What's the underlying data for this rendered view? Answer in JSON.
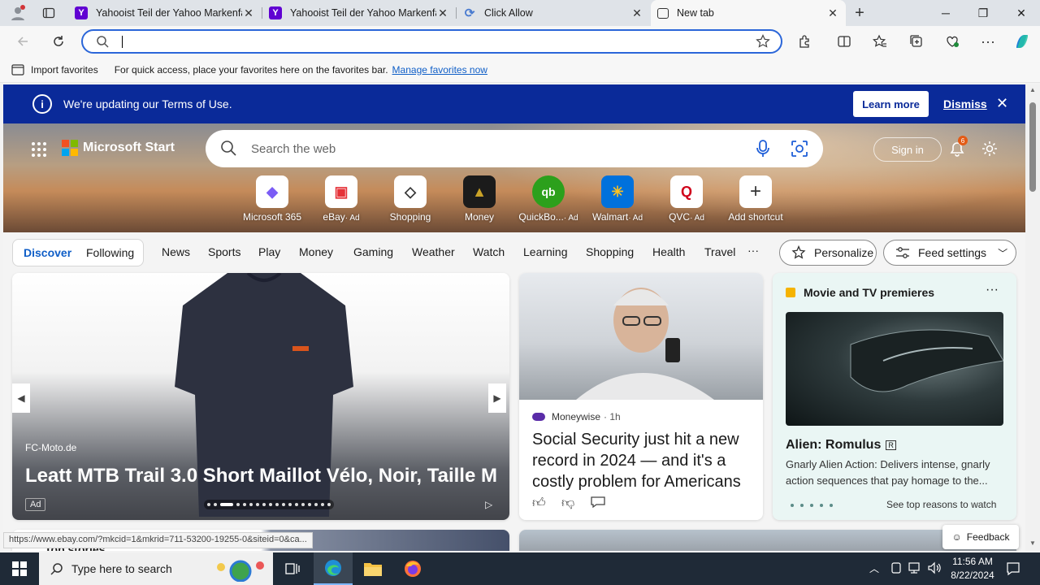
{
  "tabs": [
    {
      "title": "Yahooist Teil der Yahoo Markenfamilie",
      "favicon": "yahoo-icon",
      "color": "#6001d2"
    },
    {
      "title": "Yahooist Teil der Yahoo Markenfamilie",
      "favicon": "yahoo-icon",
      "color": "#6001d2"
    },
    {
      "title": "Click Allow",
      "favicon": "refresh-icon",
      "color": "#4a7bd0"
    },
    {
      "title": "New tab",
      "favicon": "newtab-icon",
      "color": "#333333"
    }
  ],
  "window_controls": {
    "minimize": "─",
    "restore": "❐",
    "close": "✕"
  },
  "address_bar": {
    "value": "",
    "placeholder": ""
  },
  "favorites_bar": {
    "import_label": "Import favorites",
    "message": "For quick access, place your favorites here on the favorites bar.",
    "manage_link": "Manage favorites now"
  },
  "notice": {
    "text": "We're updating our Terms of Use.",
    "learn_more": "Learn more",
    "dismiss": "Dismiss"
  },
  "header": {
    "brand": "Microsoft Start",
    "search_placeholder": "Search the web",
    "sign_in": "Sign in",
    "notification_count": "6"
  },
  "shortcuts": [
    {
      "label": "Microsoft 365",
      "ad": "",
      "icon": "m365-icon",
      "glyph": "◆",
      "color": "#7b5cf5"
    },
    {
      "label": "eBay",
      "ad": "· Ad",
      "icon": "ebay-icon",
      "glyph": "▣",
      "color": "#e53238"
    },
    {
      "label": "Shopping",
      "ad": "",
      "icon": "tag-icon",
      "glyph": "◇",
      "color": "#333333"
    },
    {
      "label": "Money",
      "ad": "",
      "icon": "money-icon",
      "glyph": "▲",
      "color": "#c9a227"
    },
    {
      "label": "QuickBo...",
      "ad": "· Ad",
      "icon": "quickbooks-icon",
      "glyph": "qb",
      "color": "#2ca01c"
    },
    {
      "label": "Walmart",
      "ad": "· Ad",
      "icon": "walmart-icon",
      "glyph": "✳",
      "color": "#0071dc"
    },
    {
      "label": "QVC",
      "ad": "· Ad",
      "icon": "qvc-icon",
      "glyph": "Q",
      "color": "#d0021b"
    },
    {
      "label": "Add shortcut",
      "ad": "",
      "icon": "plus-icon",
      "glyph": "+",
      "color": "#333333"
    }
  ],
  "feed_nav": {
    "discover": "Discover",
    "following": "Following",
    "items": [
      "News",
      "Sports",
      "Play",
      "Money",
      "Gaming",
      "Weather",
      "Watch",
      "Learning",
      "Shopping",
      "Health",
      "Travel"
    ],
    "more": "···",
    "personalize": "Personalize",
    "feed_settings": "Feed settings"
  },
  "ad_card": {
    "source": "FC-Moto.de",
    "headline": "Leatt MTB Trail 3.0 Short Maillot Vélo, Noir, Taille M",
    "ad_label": "Ad"
  },
  "news_card": {
    "publisher": "Moneywise",
    "age": "· 1h",
    "headline": "Social Security just hit a new record in 2024 — and it's a costly problem for Americans"
  },
  "movie_card": {
    "header": "Movie and TV premieres",
    "title": "Alien: Romulus",
    "rating": "R",
    "description": "Gnarly Alien Action: Delivers intense, gnarly action sequences that pay homage to the...",
    "see_top": "See top reasons to watch"
  },
  "lower": {
    "top_stories": "Top stories"
  },
  "feedback": "Feedback",
  "status_url": "https://www.ebay.com/?mkcid=1&mkrid=711-53200-19255-0&siteid=0&ca...",
  "taskbar": {
    "search_placeholder": "Type here to search",
    "time": "11:56 AM",
    "date": "8/22/2024"
  }
}
